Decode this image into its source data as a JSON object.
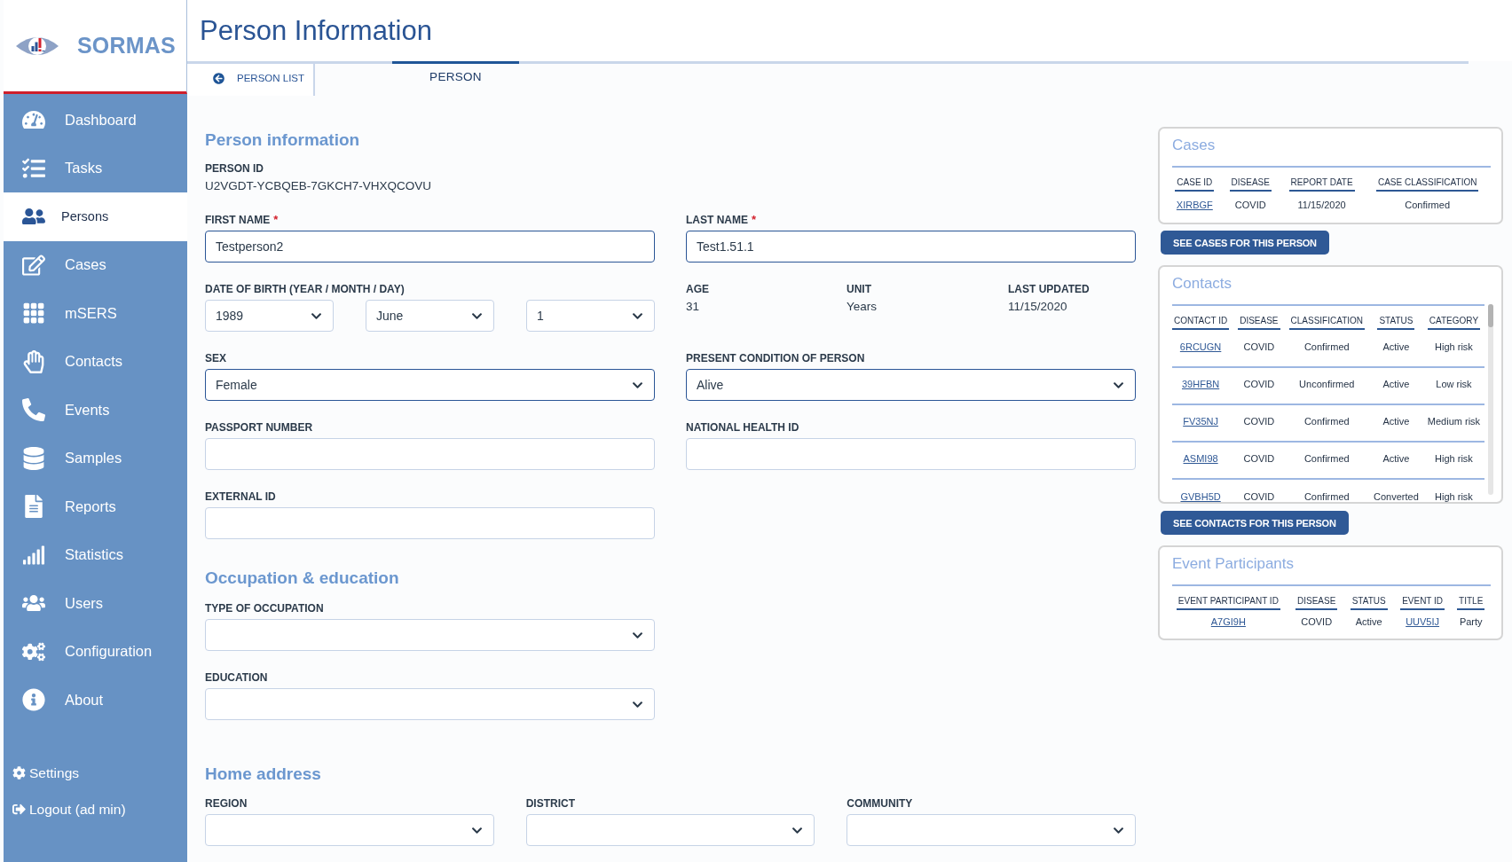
{
  "logo": {
    "text": "SORMAS"
  },
  "sidebar": {
    "items": [
      {
        "label": "Dashboard",
        "selected": false
      },
      {
        "label": "Tasks",
        "selected": false
      },
      {
        "label": "Persons",
        "selected": true
      },
      {
        "label": "Cases",
        "selected": false
      },
      {
        "label": "mSERS",
        "selected": false
      },
      {
        "label": "Contacts",
        "selected": false
      },
      {
        "label": "Events",
        "selected": false
      },
      {
        "label": "Samples",
        "selected": false
      },
      {
        "label": "Reports",
        "selected": false
      },
      {
        "label": "Statistics",
        "selected": false
      },
      {
        "label": "Users",
        "selected": false
      },
      {
        "label": "Configuration",
        "selected": false
      },
      {
        "label": "About",
        "selected": false
      }
    ],
    "footer": [
      {
        "label": "Settings"
      },
      {
        "label": "Logout (ad min)"
      }
    ]
  },
  "page_title": "Person Information",
  "back_link": {
    "label": "PERSON LIST"
  },
  "tabs": [
    {
      "label": "PERSON",
      "selected": true
    }
  ],
  "person_information": {
    "title": "Person information",
    "person_id": {
      "label": "PERSON ID",
      "value": "U2VGDT-YCBQEB-7GKCH7-VHXQCOVU"
    },
    "first_name": {
      "label": "FIRST NAME",
      "required_mark": "*",
      "value": "Testperson2",
      "highlighted": true
    },
    "last_name": {
      "label": "LAST NAME",
      "required_mark": "*",
      "value": "Test1.51.1",
      "highlighted": true
    },
    "date_of_birth": {
      "label": "DATE OF BIRTH (YEAR / MONTH / DAY)",
      "selects": [
        {
          "value": "1989",
          "highlighted": false
        },
        {
          "value": "June",
          "highlighted": false
        },
        {
          "value": "1",
          "highlighted": false
        }
      ]
    },
    "readouts": [
      {
        "label": "AGE",
        "value": "31"
      },
      {
        "label": "UNIT",
        "value": "Years"
      },
      {
        "label": "LAST UPDATED",
        "value": "11/15/2020"
      }
    ],
    "sex": {
      "label": "SEX",
      "value": "Female",
      "highlighted": true
    },
    "present_condition": {
      "label": "PRESENT CONDITION OF PERSON",
      "value": "Alive",
      "highlighted": true
    },
    "passport_number": {
      "label": "PASSPORT NUMBER",
      "highlighted": false
    },
    "national_health_id": {
      "label": "NATIONAL HEALTH ID",
      "highlighted": false
    },
    "external_id": {
      "label": "EXTERNAL ID",
      "highlighted": false
    }
  },
  "occupation_education": {
    "title": "Occupation & education",
    "type_of_occupation": {
      "label": "TYPE OF OCCUPATION",
      "highlighted": false
    },
    "education": {
      "label": "EDUCATION",
      "highlighted": false
    }
  },
  "home_address": {
    "title": "Home address",
    "fields": [
      {
        "label": "REGION",
        "highlighted": false
      },
      {
        "label": "DISTRICT",
        "highlighted": false
      },
      {
        "label": "COMMUNITY",
        "highlighted": false
      }
    ]
  },
  "cases": {
    "title": "Cases",
    "columns": [
      {
        "label": "CASE ID",
        "kind": "link"
      },
      {
        "label": "DISEASE",
        "kind": "text"
      },
      {
        "label": "REPORT DATE",
        "kind": "text"
      },
      {
        "label": "CASE CLASSIFICATION",
        "kind": "text"
      }
    ],
    "rows": [
      [
        "XIRBGF",
        "COVID",
        "11/15/2020",
        "Confirmed"
      ]
    ],
    "button": "SEE CASES FOR THIS PERSON"
  },
  "contacts": {
    "title": "Contacts",
    "columns": [
      {
        "label": "CONTACT ID",
        "kind": "link"
      },
      {
        "label": "DISEASE",
        "kind": "text"
      },
      {
        "label": "CLASSIFICATION",
        "kind": "text"
      },
      {
        "label": "STATUS",
        "kind": "text"
      },
      {
        "label": "CATEGORY",
        "kind": "text"
      }
    ],
    "rows": [
      [
        "6RCUGN",
        "COVID",
        "Confirmed",
        "Active",
        "High risk"
      ],
      [
        "39HFBN",
        "COVID",
        "Unconfirmed",
        "Active",
        "Low risk"
      ],
      [
        "FV35NJ",
        "COVID",
        "Confirmed",
        "Active",
        "Medium risk"
      ],
      [
        "ASMI98",
        "COVID",
        "Confirmed",
        "Active",
        "High risk"
      ],
      [
        "GVBH5D",
        "COVID",
        "Confirmed",
        "Converted",
        "High risk"
      ]
    ],
    "button": "SEE CONTACTS FOR THIS PERSON"
  },
  "event_participants": {
    "title": "Event Participants",
    "columns": [
      {
        "label": "EVENT PARTICIPANT ID",
        "kind": "link"
      },
      {
        "label": "DISEASE",
        "kind": "text"
      },
      {
        "label": "STATUS",
        "kind": "text"
      },
      {
        "label": "EVENT ID",
        "kind": "link"
      },
      {
        "label": "TITLE",
        "kind": "text"
      }
    ],
    "rows": [
      [
        "A7GI9H",
        "COVID",
        "Active",
        "UUV5IJ",
        "Party"
      ]
    ]
  }
}
